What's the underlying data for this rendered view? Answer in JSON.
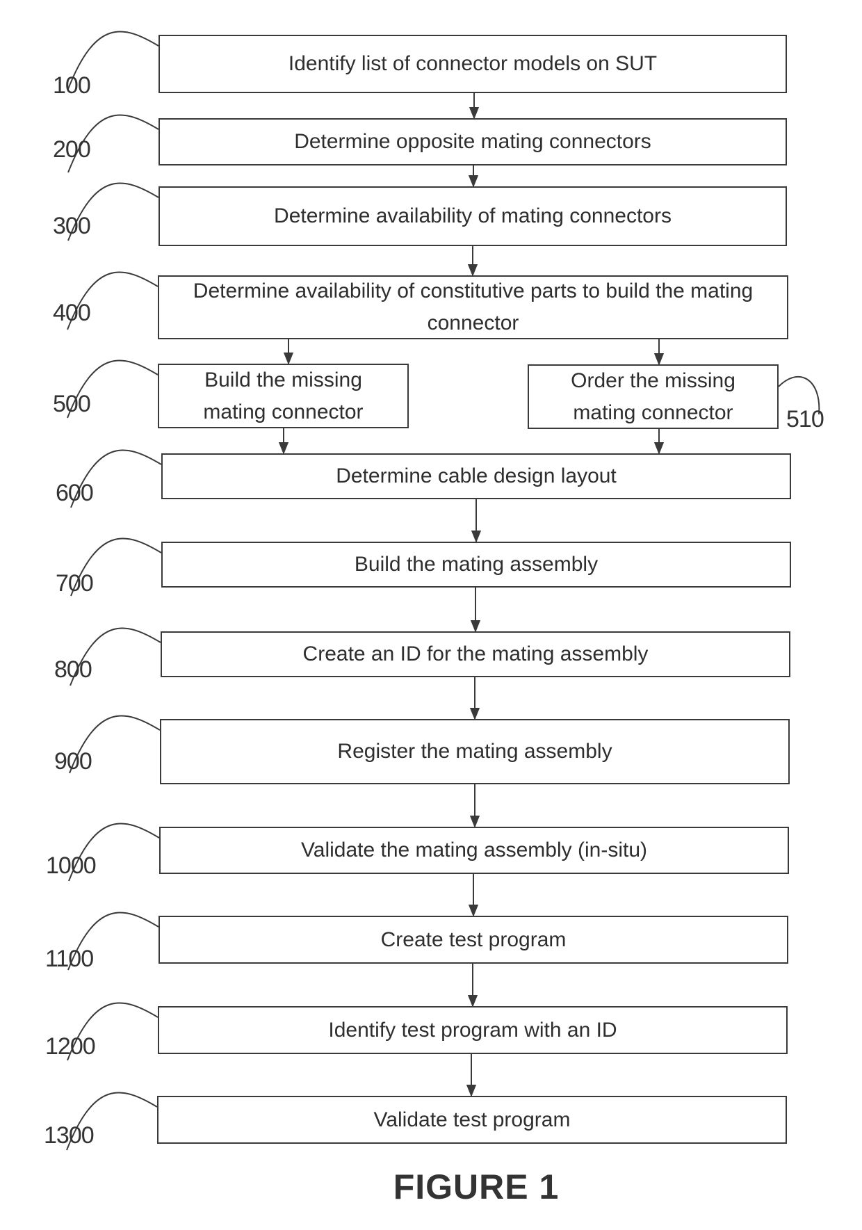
{
  "figure": {
    "caption": "FIGURE 1",
    "steps": [
      {
        "ref": "100",
        "text": "Identify list of connector models on SUT"
      },
      {
        "ref": "200",
        "text": "Determine opposite mating connectors"
      },
      {
        "ref": "300",
        "text": "Determine availability of mating connectors"
      },
      {
        "ref": "400",
        "text": "Determine availability of constitutive parts to build the mating connector"
      },
      {
        "ref": "500",
        "text": "Build the missing mating connector"
      },
      {
        "ref": "510",
        "text": "Order the missing mating connector"
      },
      {
        "ref": "600",
        "text": "Determine cable design layout"
      },
      {
        "ref": "700",
        "text": "Build the mating assembly"
      },
      {
        "ref": "800",
        "text": "Create an ID for the mating assembly"
      },
      {
        "ref": "900",
        "text": "Register the mating assembly"
      },
      {
        "ref": "1000",
        "text": "Validate the mating assembly (in-situ)"
      },
      {
        "ref": "1100",
        "text": "Create test program"
      },
      {
        "ref": "1200",
        "text": "Identify test program with an ID"
      },
      {
        "ref": "1300",
        "text": "Validate test program"
      }
    ],
    "connections": [
      [
        "100",
        "200"
      ],
      [
        "200",
        "300"
      ],
      [
        "300",
        "400"
      ],
      [
        "400",
        "500"
      ],
      [
        "400",
        "510"
      ],
      [
        "500",
        "600"
      ],
      [
        "510",
        "600"
      ],
      [
        "600",
        "700"
      ],
      [
        "700",
        "800"
      ],
      [
        "800",
        "900"
      ],
      [
        "900",
        "1000"
      ],
      [
        "1000",
        "1100"
      ],
      [
        "1100",
        "1200"
      ],
      [
        "1200",
        "1300"
      ]
    ]
  }
}
